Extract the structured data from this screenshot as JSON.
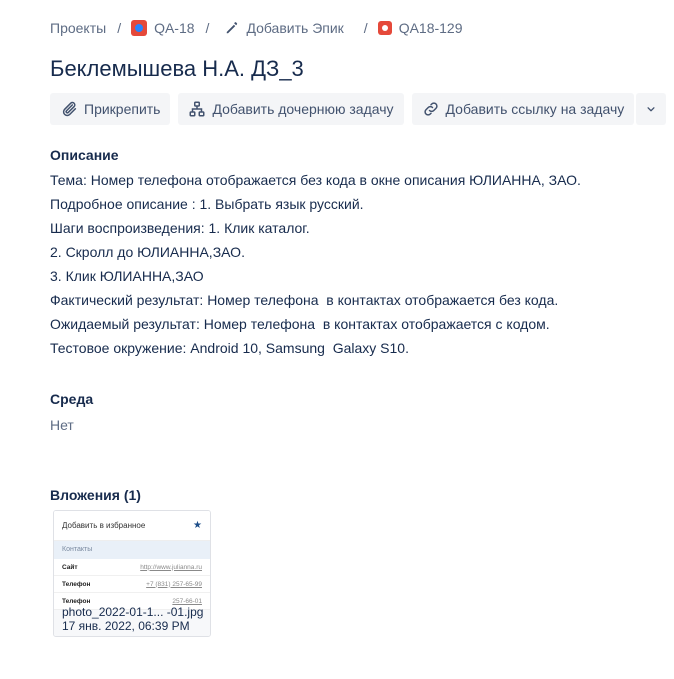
{
  "breadcrumbs": {
    "projects": "Проекты",
    "project": "QA-18",
    "epic": "Добавить Эпик",
    "issue": "QA18-129",
    "separator": "/"
  },
  "issue": {
    "title": "Беклемышева Н.А. ДЗ_3"
  },
  "toolbar": {
    "attach": "Прикрепить",
    "add_child": "Добавить дочернюю задачу",
    "add_link": "Добавить ссылку на задачу"
  },
  "description": {
    "label": "Описание",
    "lines": [
      "Тема: Номер телефона отображается без кода в окне описания ЮЛИАННА, ЗАО.",
      "Подробное описание : 1. Выбрать язык русский.",
      "Шаги воспроизведения: 1. Клик каталог.",
      "2. Скролл до ЮЛИАННА,ЗАО.",
      "3. Клик ЮЛИАННА,ЗАО",
      "Фактический результат: Номер телефона  в контактах отображается без кода.",
      "Ожидаемый результат: Номер телефона  в контактах отображается с кодом.",
      "Тестовое окружение: Android 10, Samsung  Galaxy S10."
    ]
  },
  "environment": {
    "label": "Среда",
    "value": "Нет"
  },
  "attachments": {
    "label": "Вложения (1)",
    "items": [
      {
        "filename": "photo_2022-01-1... -01.jpg",
        "date": "17 янв. 2022, 06:39 PM",
        "thumb": {
          "header": "Добавить в избранное",
          "section": "Контакты",
          "rows": [
            {
              "k": "Сайт",
              "v": "http://www.julianna.ru"
            },
            {
              "k": "Телефон",
              "v": "+7 (831) 257-65-99"
            },
            {
              "k": "Телефон",
              "v": "257-66-01"
            }
          ]
        }
      }
    ]
  },
  "colors": {
    "text": "#172b4d",
    "muted": "#5e6c84",
    "button_bg": "#f4f5f7",
    "bug_red": "#e5493a"
  }
}
